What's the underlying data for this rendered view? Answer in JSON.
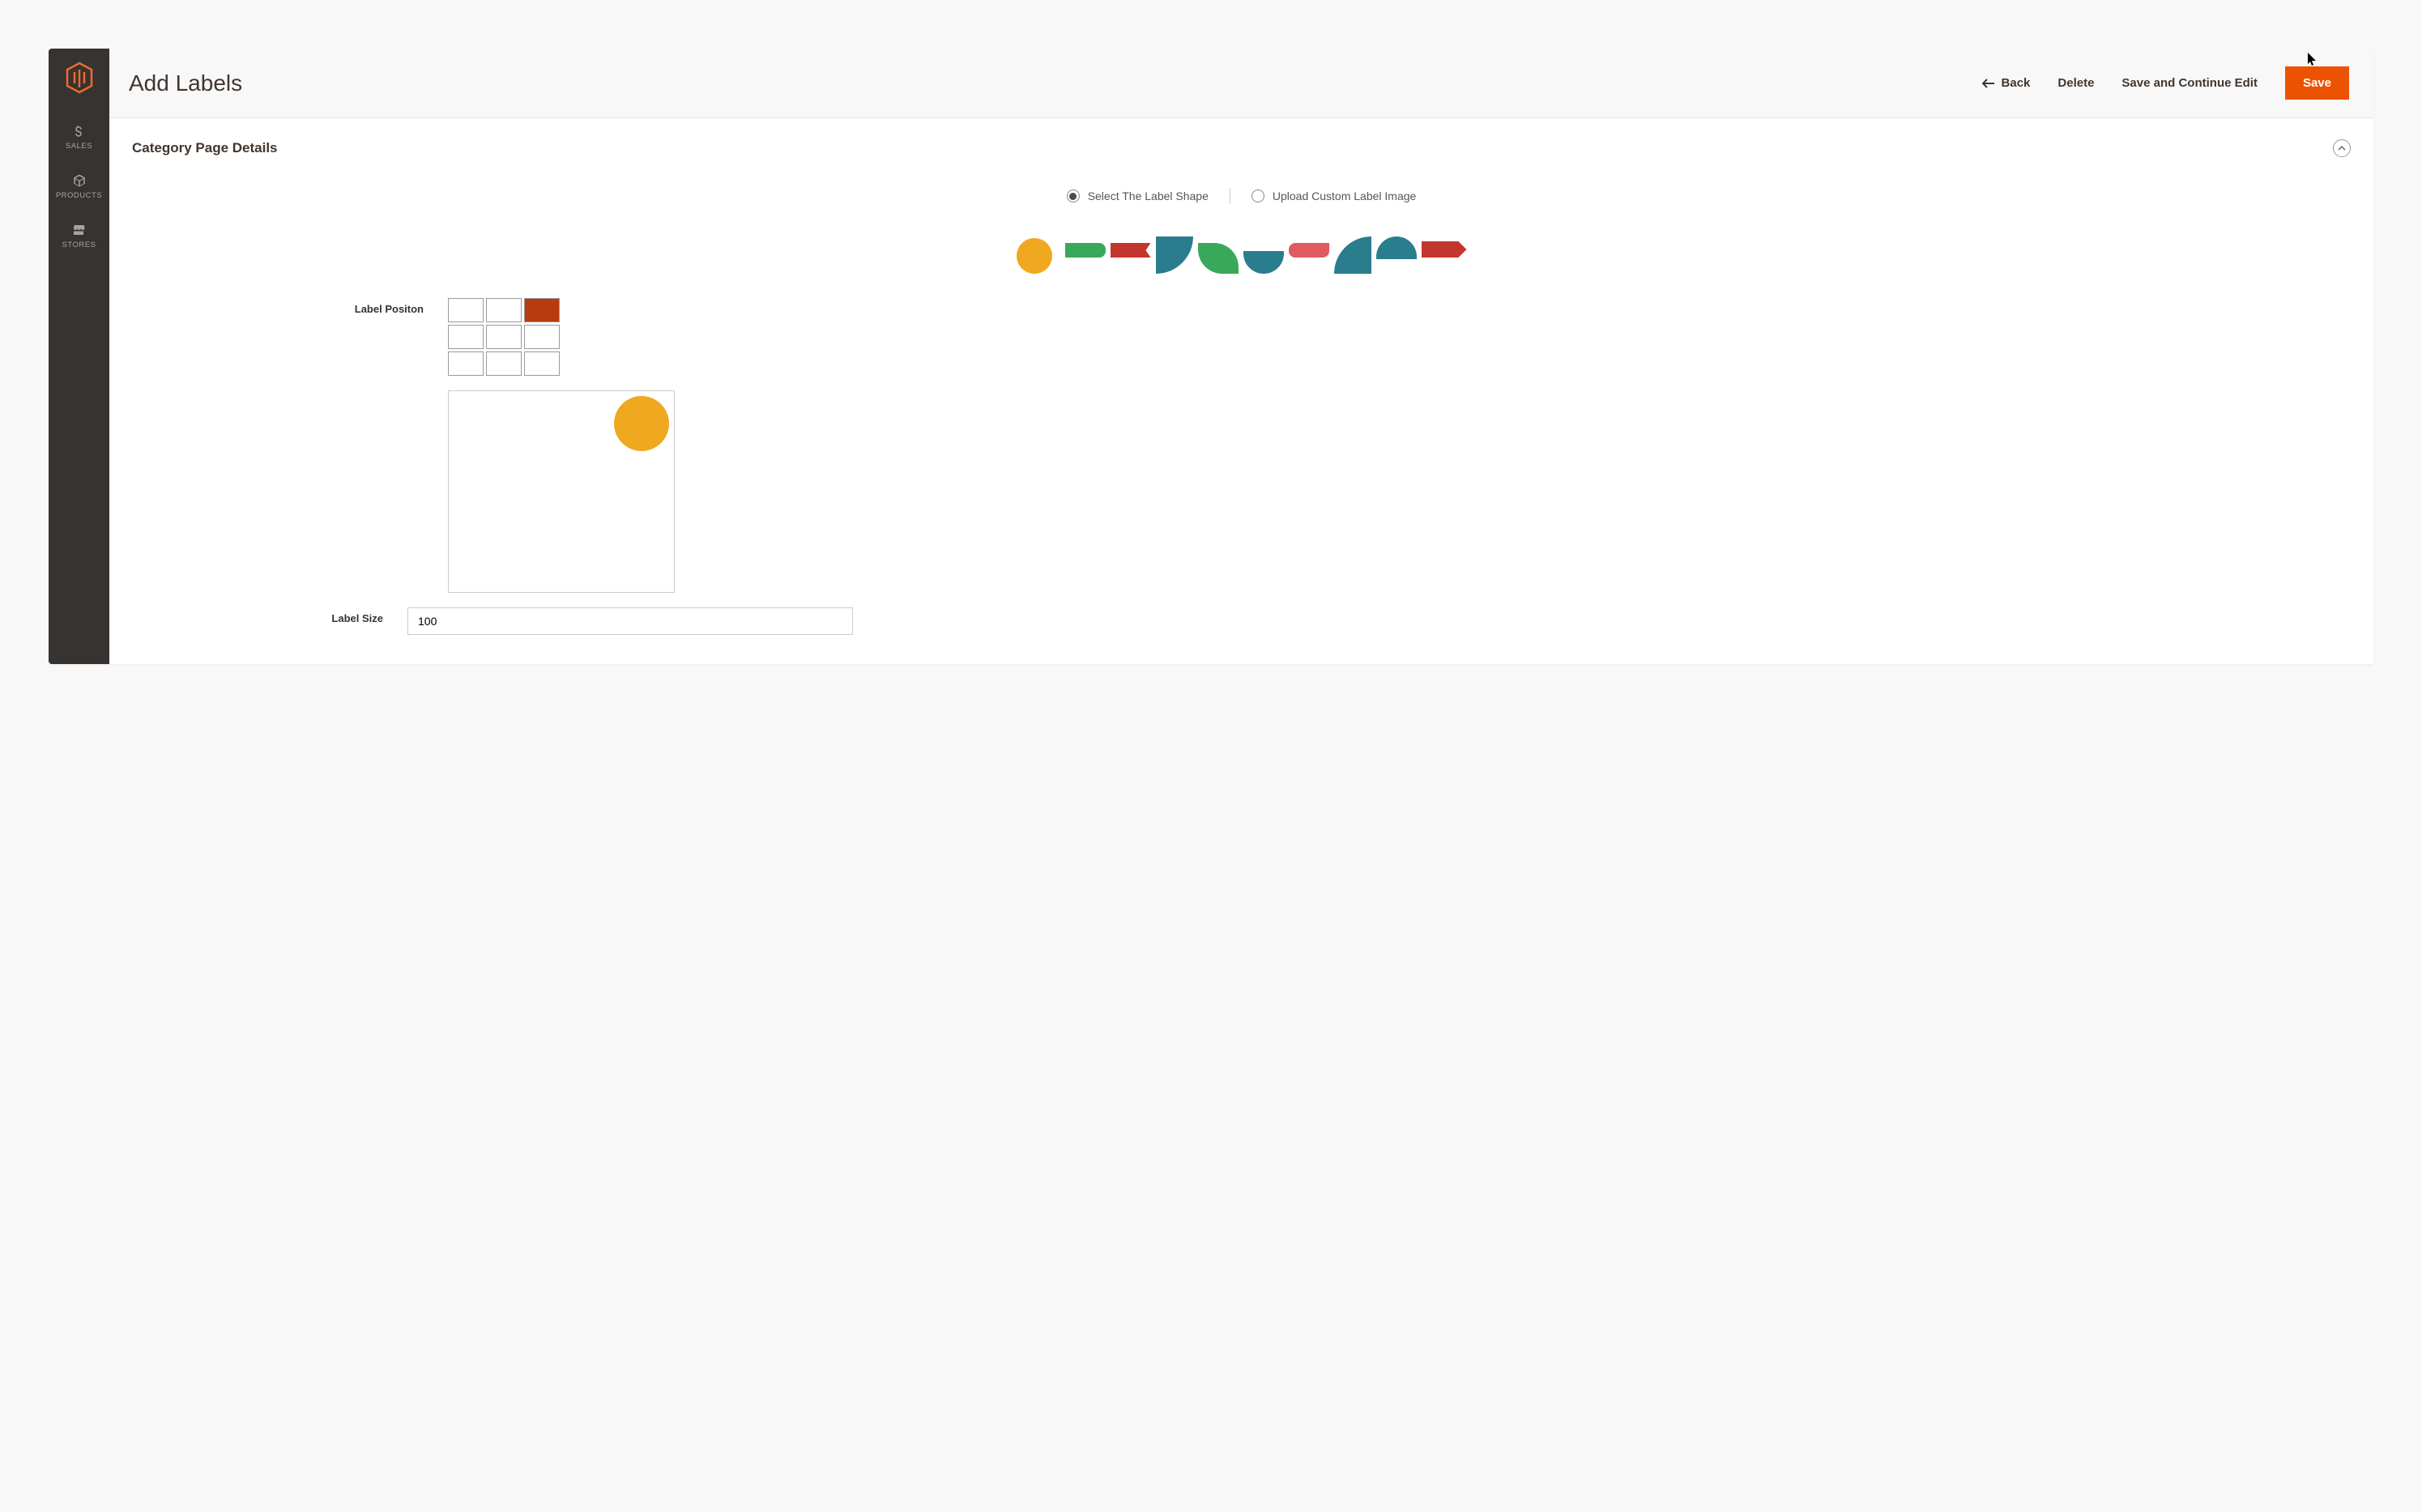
{
  "sidebar": {
    "items": [
      {
        "label": "SALES",
        "icon": "dollar-icon"
      },
      {
        "label": "PRODUCTS",
        "icon": "cube-icon"
      },
      {
        "label": "STORES",
        "icon": "store-icon"
      }
    ]
  },
  "header": {
    "title": "Add Labels",
    "back_label": "Back",
    "delete_label": "Delete",
    "save_continue_label": "Save and Continue Edit",
    "save_label": "Save"
  },
  "section": {
    "title": "Category Page Details",
    "radio_shape": "Select The Label Shape",
    "radio_upload": "Upload Custom Label Image",
    "radio_selected": "shape",
    "shapes": [
      "circle",
      "bar-green",
      "flag-red",
      "quarter-teal",
      "leaf-green",
      "halfbot-teal",
      "tab-red",
      "quarter-tl",
      "halftop-teal",
      "arrow-red"
    ],
    "label_position": {
      "label": "Label Positon",
      "cells": 9,
      "active_index": 2
    },
    "preview": {
      "position_index": 2,
      "shape": "circle"
    },
    "label_size": {
      "label": "Label Size",
      "value": "100"
    }
  },
  "colors": {
    "accent": "#eb5202",
    "sidebar_bg": "#373330",
    "teal": "#2a7d8c",
    "green": "#39a85a",
    "red": "#c3362d",
    "yellow": "#f0a820"
  }
}
